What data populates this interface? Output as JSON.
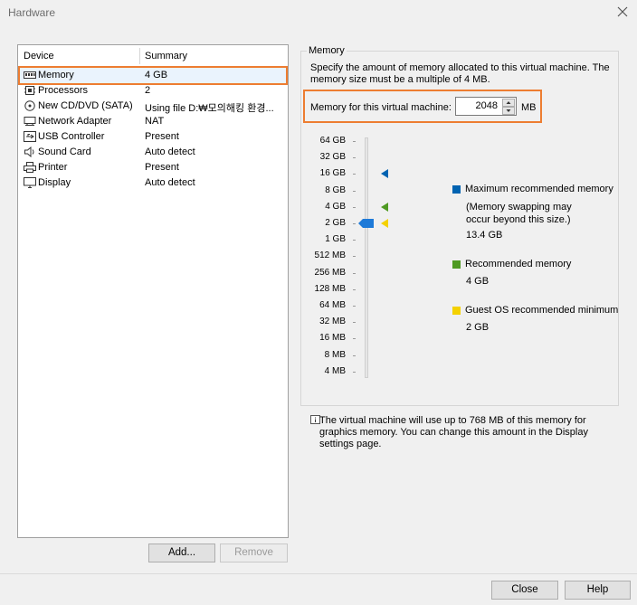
{
  "window": {
    "title": "Hardware"
  },
  "device_table": {
    "columns": [
      "Device",
      "Summary"
    ],
    "rows": [
      {
        "name": "Memory",
        "summary": "4 GB",
        "icon": "memory-icon"
      },
      {
        "name": "Processors",
        "summary": "2",
        "icon": "processor-icon"
      },
      {
        "name": "New CD/DVD (SATA)",
        "summary": "Using file D:₩모의해킹 환경...",
        "icon": "cd-dvd-icon"
      },
      {
        "name": "Network Adapter",
        "summary": "NAT",
        "icon": "network-adapter-icon"
      },
      {
        "name": "USB Controller",
        "summary": "Present",
        "icon": "usb-icon"
      },
      {
        "name": "Sound Card",
        "summary": "Auto detect",
        "icon": "speaker-icon"
      },
      {
        "name": "Printer",
        "summary": "Present",
        "icon": "printer-icon"
      },
      {
        "name": "Display",
        "summary": "Auto detect",
        "icon": "display-icon"
      }
    ]
  },
  "buttons": {
    "add": "Add...",
    "remove": "Remove",
    "close": "Close",
    "help": "Help"
  },
  "memory": {
    "group_title": "Memory",
    "description": "Specify the amount of memory allocated to this virtual machine. The memory size must be a multiple of 4 MB.",
    "field_label": "Memory for this virtual machine:",
    "value": "2048",
    "unit": "MB",
    "scale": [
      "64 GB",
      "32 GB",
      "16 GB",
      "8 GB",
      "4 GB",
      "2 GB",
      "1 GB",
      "512 MB",
      "256 MB",
      "128 MB",
      "64 MB",
      "32 MB",
      "16 MB",
      "8 MB",
      "4 MB"
    ],
    "slider_value": "2 GB",
    "markers": {
      "max_recommended": "16 GB",
      "recommended": "4 GB",
      "guest_min": "2 GB"
    },
    "legend": {
      "max_label": "Maximum recommended memory",
      "max_note": "(Memory swapping may occur beyond this size.)",
      "max_value": "13.4 GB",
      "rec_label": "Recommended memory",
      "rec_value": "4 GB",
      "min_label": "Guest OS recommended minimum",
      "min_value": "2 GB"
    },
    "info": "The virtual machine will use up to 768 MB of this memory for graphics memory. You can change this amount in the Display settings page."
  },
  "colors": {
    "highlight": "#ed7d31",
    "max_blue": "#0063b1",
    "rec_green": "#4f9a23",
    "min_yellow": "#f4d100",
    "thumb_blue": "#1e7ad8"
  }
}
